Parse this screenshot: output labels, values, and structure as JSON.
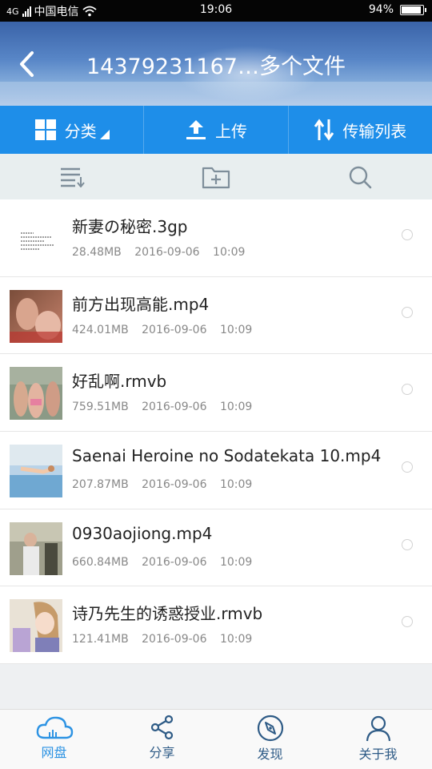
{
  "status_bar": {
    "network": "4G",
    "carrier": "中国电信",
    "time": "19:06",
    "battery": "94%",
    "battery_level": 0.94
  },
  "header": {
    "title": "14379231167…多个文件",
    "back_icon": "chevron-left-icon"
  },
  "actions": [
    {
      "label": "分类",
      "icon": "grid-icon"
    },
    {
      "label": "上传",
      "icon": "upload-icon"
    },
    {
      "label": "传输列表",
      "icon": "transfer-icon"
    }
  ],
  "toolbar": {
    "icons": [
      "sort-list-icon",
      "new-folder-icon",
      "search-icon"
    ]
  },
  "files": [
    {
      "name": "新妻の秘密.3gp",
      "size": "28.48MB",
      "date": "2016-09-06",
      "time": "10:09",
      "thumb": "text-doc"
    },
    {
      "name": "前方出现高能.mp4",
      "size": "424.01MB",
      "date": "2016-09-06",
      "time": "10:09",
      "thumb": "photo"
    },
    {
      "name": "好乱啊.rmvb",
      "size": "759.51MB",
      "date": "2016-09-06",
      "time": "10:09",
      "thumb": "photo"
    },
    {
      "name": "Saenai Heroine no Sodatekata 10.mp4",
      "size": "207.87MB",
      "date": "2016-09-06",
      "time": "10:09",
      "thumb": "anime"
    },
    {
      "name": "0930aojiong.mp4",
      "size": "660.84MB",
      "date": "2016-09-06",
      "time": "10:09",
      "thumb": "photo"
    },
    {
      "name": "诗乃先生的诱惑授业.rmvb",
      "size": "121.41MB",
      "date": "2016-09-06",
      "time": "10:09",
      "thumb": "anime"
    }
  ],
  "nav": [
    {
      "label": "网盘",
      "icon": "cloud-icon",
      "active": true
    },
    {
      "label": "分享",
      "icon": "share-icon",
      "active": false
    },
    {
      "label": "发现",
      "icon": "compass-icon",
      "active": false
    },
    {
      "label": "关于我",
      "icon": "person-icon",
      "active": false
    }
  ],
  "colors": {
    "action_bar": "#1e8ee9",
    "nav_active": "#2d93e3",
    "nav_inactive": "#2e5b86"
  }
}
